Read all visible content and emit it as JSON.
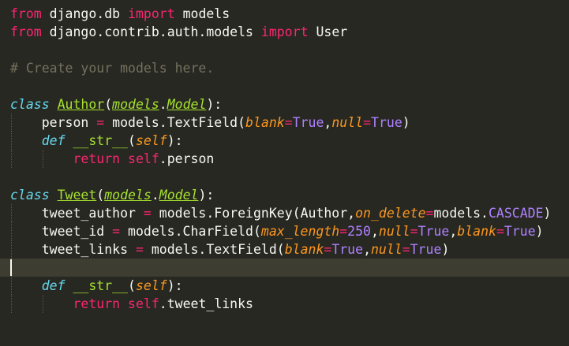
{
  "lines": [
    [
      {
        "c": "kw",
        "t": "from"
      },
      {
        "c": "plain",
        "t": " django.db "
      },
      {
        "c": "kw",
        "t": "import"
      },
      {
        "c": "plain",
        "t": " models"
      }
    ],
    [
      {
        "c": "kw",
        "t": "from"
      },
      {
        "c": "plain",
        "t": " django.contrib.auth.models "
      },
      {
        "c": "kw",
        "t": "import"
      },
      {
        "c": "plain",
        "t": " User"
      }
    ],
    [],
    [
      {
        "c": "comment",
        "t": "# Create your models here."
      }
    ],
    [],
    [
      {
        "c": "storage",
        "t": "class"
      },
      {
        "c": "plain",
        "t": " "
      },
      {
        "c": "cls",
        "t": "Author"
      },
      {
        "c": "plain",
        "t": "("
      },
      {
        "c": "inh",
        "t": "models"
      },
      {
        "c": "plain",
        "t": "."
      },
      {
        "c": "inh",
        "t": "Model"
      },
      {
        "c": "plain",
        "t": "):"
      }
    ],
    [
      {
        "c": "plain",
        "t": "    person "
      },
      {
        "c": "op",
        "t": "="
      },
      {
        "c": "plain",
        "t": " models.TextField("
      },
      {
        "c": "param",
        "t": "blank"
      },
      {
        "c": "op",
        "t": "="
      },
      {
        "c": "const",
        "t": "True"
      },
      {
        "c": "plain",
        "t": ","
      },
      {
        "c": "param",
        "t": "null"
      },
      {
        "c": "op",
        "t": "="
      },
      {
        "c": "const",
        "t": "True"
      },
      {
        "c": "plain",
        "t": ")"
      }
    ],
    [
      {
        "c": "plain",
        "t": "    "
      },
      {
        "c": "storage",
        "t": "def"
      },
      {
        "c": "plain",
        "t": " "
      },
      {
        "c": "fnname",
        "t": "__str__"
      },
      {
        "c": "plain",
        "t": "("
      },
      {
        "c": "self",
        "t": "self"
      },
      {
        "c": "plain",
        "t": "):"
      }
    ],
    [
      {
        "c": "plain",
        "t": "        "
      },
      {
        "c": "kw",
        "t": "return"
      },
      {
        "c": "plain",
        "t": " "
      },
      {
        "c": "kwself",
        "t": "self"
      },
      {
        "c": "plain",
        "t": ".person"
      }
    ],
    [],
    [
      {
        "c": "storage",
        "t": "class"
      },
      {
        "c": "plain",
        "t": " "
      },
      {
        "c": "cls",
        "t": "Tweet"
      },
      {
        "c": "plain",
        "t": "("
      },
      {
        "c": "inh",
        "t": "models"
      },
      {
        "c": "plain",
        "t": "."
      },
      {
        "c": "inh",
        "t": "Model"
      },
      {
        "c": "plain",
        "t": "):"
      }
    ],
    [
      {
        "c": "plain",
        "t": "    tweet_author "
      },
      {
        "c": "op",
        "t": "="
      },
      {
        "c": "plain",
        "t": " models.ForeignKey(Author,"
      },
      {
        "c": "param",
        "t": "on_delete"
      },
      {
        "c": "op",
        "t": "="
      },
      {
        "c": "plain",
        "t": "models."
      },
      {
        "c": "const",
        "t": "CASCADE"
      },
      {
        "c": "plain",
        "t": ")"
      }
    ],
    [
      {
        "c": "plain",
        "t": "    tweet_id "
      },
      {
        "c": "op",
        "t": "="
      },
      {
        "c": "plain",
        "t": " models.CharField("
      },
      {
        "c": "param",
        "t": "max_length"
      },
      {
        "c": "op",
        "t": "="
      },
      {
        "c": "num",
        "t": "250"
      },
      {
        "c": "plain",
        "t": ","
      },
      {
        "c": "param",
        "t": "null"
      },
      {
        "c": "op",
        "t": "="
      },
      {
        "c": "const",
        "t": "True"
      },
      {
        "c": "plain",
        "t": ","
      },
      {
        "c": "param",
        "t": "blank"
      },
      {
        "c": "op",
        "t": "="
      },
      {
        "c": "const",
        "t": "True"
      },
      {
        "c": "plain",
        "t": ")"
      }
    ],
    [
      {
        "c": "plain",
        "t": "    tweet_links "
      },
      {
        "c": "op",
        "t": "="
      },
      {
        "c": "plain",
        "t": " models.TextField("
      },
      {
        "c": "param",
        "t": "blank"
      },
      {
        "c": "op",
        "t": "="
      },
      {
        "c": "const",
        "t": "True"
      },
      {
        "c": "plain",
        "t": ","
      },
      {
        "c": "param",
        "t": "null"
      },
      {
        "c": "op",
        "t": "="
      },
      {
        "c": "const",
        "t": "True"
      },
      {
        "c": "plain",
        "t": ")"
      }
    ],
    [],
    [
      {
        "c": "plain",
        "t": "    "
      },
      {
        "c": "storage",
        "t": "def"
      },
      {
        "c": "plain",
        "t": " "
      },
      {
        "c": "fnname",
        "t": "__str__"
      },
      {
        "c": "plain",
        "t": "("
      },
      {
        "c": "self",
        "t": "self"
      },
      {
        "c": "plain",
        "t": "):"
      }
    ],
    [
      {
        "c": "plain",
        "t": "        "
      },
      {
        "c": "kw",
        "t": "return"
      },
      {
        "c": "plain",
        "t": " "
      },
      {
        "c": "kwself",
        "t": "self"
      },
      {
        "c": "plain",
        "t": ".tweet_links"
      }
    ]
  ],
  "current_line": 14,
  "colors": {
    "background": "#272822",
    "current_line": "#3e3d32",
    "keyword": "#f92672",
    "storage": "#66d9ef",
    "class_name": "#a6e22e",
    "parameter": "#fd971f",
    "constant": "#ae81ff",
    "comment": "#75715e",
    "text": "#f8f8f2"
  }
}
